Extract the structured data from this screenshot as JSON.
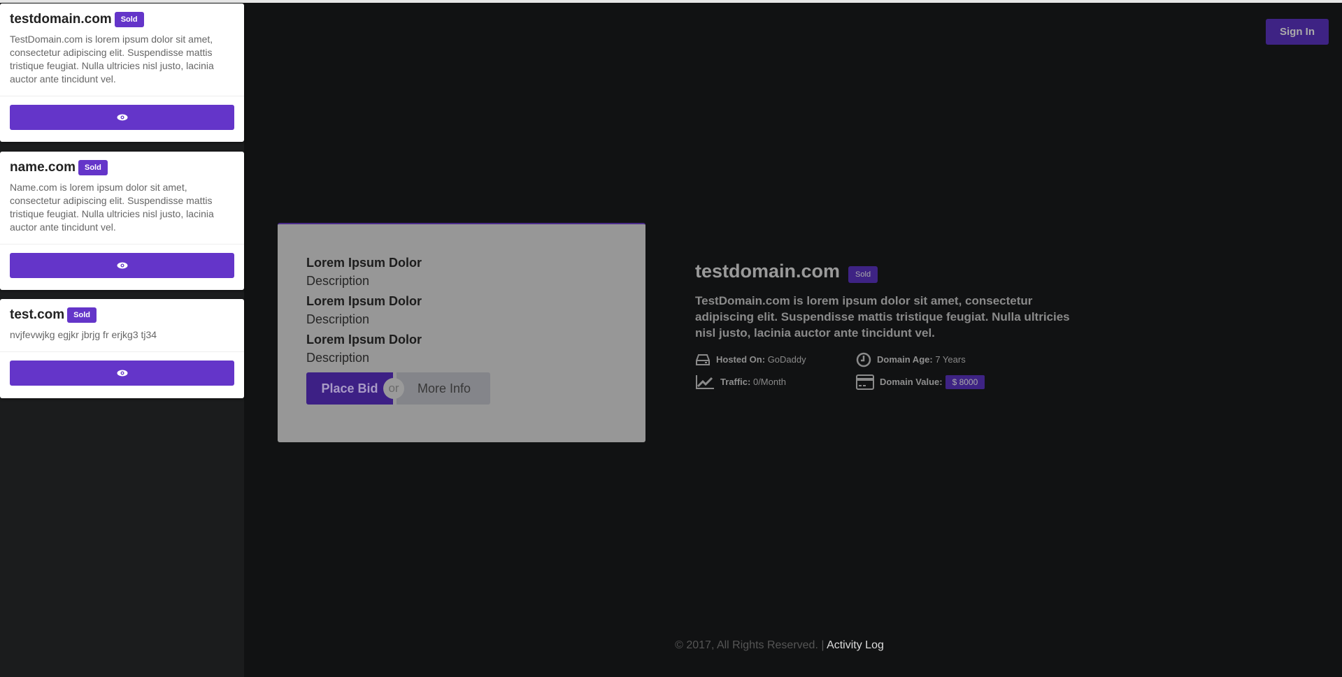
{
  "sidebar": {
    "cards": [
      {
        "name": "testdomain.com",
        "badge": "Sold",
        "description": "TestDomain.com is lorem ipsum dolor sit amet, consectetur adipiscing elit. Suspendisse mattis tristique feugiat. Nulla ultricies nisl justo, lacinia auctor ante tincidunt vel."
      },
      {
        "name": "name.com",
        "badge": "Sold",
        "description": "Name.com is lorem ipsum dolor sit amet, consectetur adipiscing elit. Suspendisse mattis tristique feugiat. Nulla ultricies nisl justo, lacinia auctor ante tincidunt vel."
      },
      {
        "name": "test.com",
        "badge": "Sold",
        "description": "nvjfevwjkg egjkr jbrjg fr erjkg3 tj34"
      }
    ]
  },
  "header": {
    "sign_in": "Sign In"
  },
  "main": {
    "items": [
      {
        "title": "Lorem Ipsum Dolor",
        "desc": "Description"
      },
      {
        "title": "Lorem Ipsum Dolor",
        "desc": "Description"
      },
      {
        "title": "Lorem Ipsum Dolor",
        "desc": "Description"
      }
    ],
    "place_bid": "Place Bid",
    "or": "or",
    "more_info": "More Info"
  },
  "domain": {
    "title": "testdomain.com",
    "badge": "Sold",
    "description": "TestDomain.com is lorem ipsum dolor sit amet, consectetur adipiscing elit. Suspendisse mattis tristique feugiat. Nulla ultricies nisl justo, lacinia auctor ante tincidunt vel.",
    "hosted_label": "Hosted On:",
    "hosted_value": "GoDaddy",
    "age_label": "Domain Age:",
    "age_value": "7 Years",
    "traffic_label": "Traffic:",
    "traffic_value": "0/Month",
    "value_label": "Domain Value:",
    "value_value": "$ 8000"
  },
  "footer": {
    "copyright": "© 2017, All Rights Reserved. |",
    "link": "Activity Log"
  },
  "colors": {
    "accent": "#6435c9",
    "dark_accent": "#3e2384"
  }
}
